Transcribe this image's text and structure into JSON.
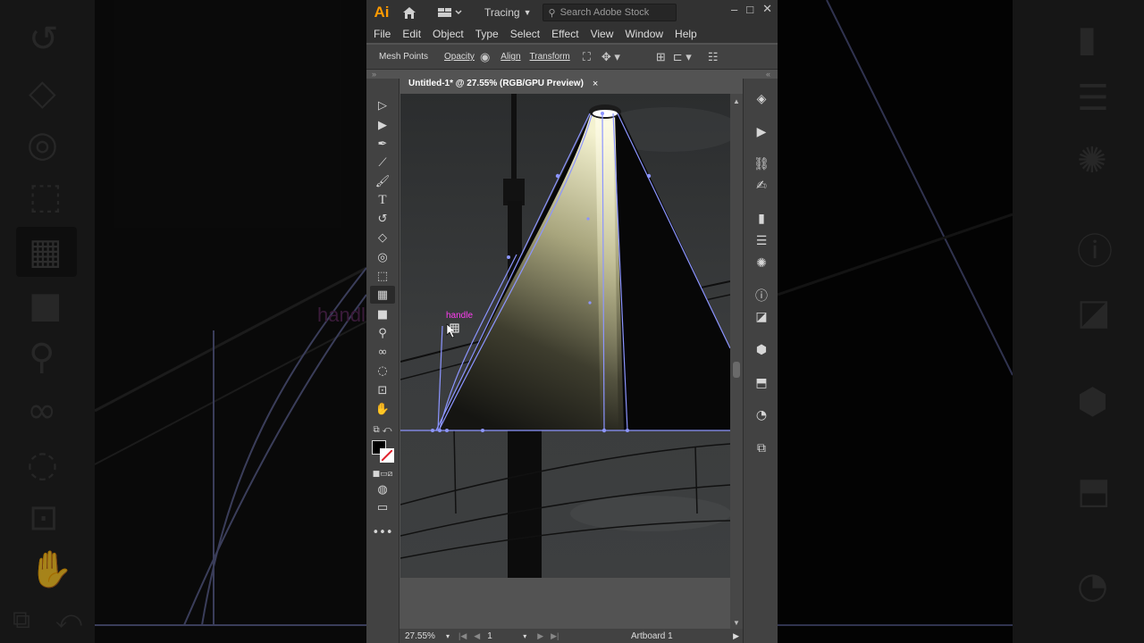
{
  "app": {
    "logo": "Ai",
    "workspace": "Tracing",
    "search_placeholder": "Search Adobe Stock"
  },
  "window_controls": [
    "–",
    "□",
    "✕"
  ],
  "menu": [
    "File",
    "Edit",
    "Object",
    "Type",
    "Select",
    "Effect",
    "View",
    "Window",
    "Help"
  ],
  "control_bar": {
    "context_label": "Mesh Points",
    "opacity": "Opacity",
    "align": "Align",
    "transform": "Transform"
  },
  "document": {
    "tab_title": "Untitled-1* @ 27.55% (RGB/GPU Preview)",
    "close": "×"
  },
  "canvas": {
    "cursor_label": "handle",
    "colors": {
      "light_cone": "#e7e4b8",
      "path_stroke": "#7b8bff",
      "label": "#ff3df3"
    }
  },
  "background_blur": {
    "cursor_label": "handle"
  },
  "status": {
    "zoom": "27.55%",
    "artboard_number": "1",
    "artboard_name": "Artboard 1"
  },
  "toolbar_icons": [
    "selection-icon",
    "direct-selection-icon",
    "pen-icon",
    "line-icon",
    "paintbrush-icon",
    "type-icon",
    "rotate-icon",
    "eraser-icon",
    "shape-builder-icon",
    "free-transform-icon",
    "mesh-icon",
    "gradient-icon",
    "zoom-icon",
    "blend-icon",
    "symbol-sprayer-icon",
    "artboard-icon",
    "hand-icon"
  ],
  "panel_icons": [
    "layers-icon",
    "actions-icon",
    "links-icon",
    "puppet-icon",
    "gradient-panel-icon",
    "stroke-icon",
    "brightness-icon",
    "info-icon",
    "pathfinder-icon",
    "3d-icon",
    "export-icon",
    "recolor-icon",
    "asset-icon"
  ]
}
